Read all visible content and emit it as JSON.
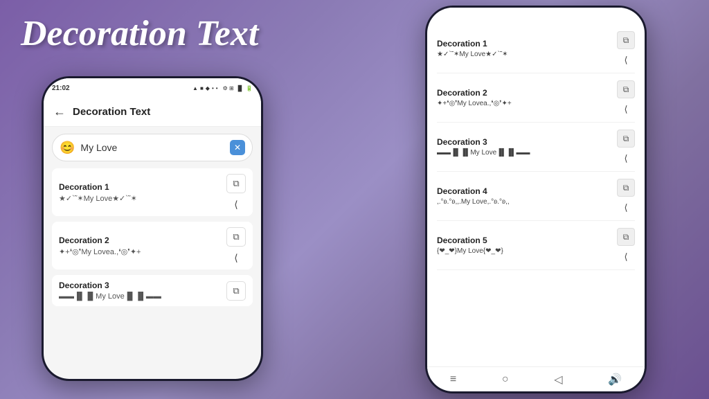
{
  "app": {
    "title": "Decoration Text",
    "background_color_start": "#7b5ea7",
    "background_color_end": "#6a5090"
  },
  "left_phone": {
    "status_time": "21:02",
    "status_icons": "▲ ■ ◆ • •",
    "status_right": "⚙ ⊞ ᵻl ▐▌ 🔋",
    "header_back": "←",
    "header_title": "Decoration Text",
    "search_placeholder": "My Love",
    "search_emoji": "😊",
    "search_clear_icon": "✕",
    "decorations": [
      {
        "title": "Decoration 1",
        "preview": "★✓`˜✶My Love★✓`˜✶"
      },
      {
        "title": "Decoration 2",
        "preview": "✦+❛◎❜My Lovea.,❛◎❜✦+"
      },
      {
        "title": "Decoration 3",
        "preview": "▬▬▐▌▐▌My Love▐▌▐▌▬▬"
      }
    ]
  },
  "right_phone": {
    "decorations": [
      {
        "title": "Decoration 1",
        "preview": "★✓`˜✶My Love★✓`˜✶"
      },
      {
        "title": "Decoration 2",
        "preview": "✦+❛◎❜My Lovea.,❛◎❜✦+"
      },
      {
        "title": "Decoration 3",
        "preview": "▬▬▐▌▐▌My Love▐▌▐▌▬▬"
      },
      {
        "title": "Decoration 4",
        "preview": ",.°ʚ.°ʚ,,.My Love,.°ʚ.°ʚ,,"
      },
      {
        "title": "Decoration 5",
        "preview": "{❤_❤}My Love{❤_❤}"
      }
    ],
    "nav_icons": [
      "≡",
      "○",
      "◁",
      "🔊"
    ]
  },
  "icons": {
    "copy": "⧉",
    "share": "≪",
    "back": "←",
    "clear": "✕"
  }
}
